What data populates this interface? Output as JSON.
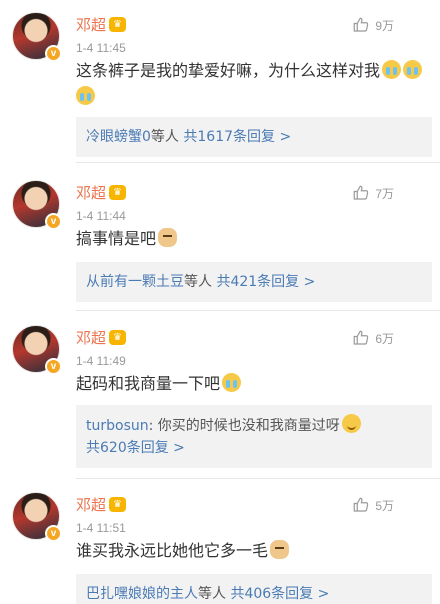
{
  "comments": [
    {
      "name": "邓超",
      "time": "1-4 11:45",
      "likes": "9万",
      "text": "这条裤子是我的挚爱好嘛，为什么这样对我",
      "emojis": [
        "cry",
        "cry",
        "cry"
      ],
      "reply": {
        "user": "冷眼螃蟹0",
        "suffix": "等人",
        "count_text": "共1617条回复 >"
      }
    },
    {
      "name": "邓超",
      "time": "1-4 11:44",
      "likes": "7万",
      "text": "搞事情是吧",
      "emojis": [
        "dog"
      ],
      "reply": {
        "user": "从前有一颗土豆",
        "suffix": "等人",
        "count_text": "共421条回复 >"
      }
    },
    {
      "name": "邓超",
      "time": "1-4 11:49",
      "likes": "6万",
      "text": "起码和我商量一下吧",
      "emojis": [
        "cry"
      ],
      "reply": {
        "user": "turbosun",
        "message": ": 你买的时候也没和我商量过呀",
        "count_text": "共620条回复 >"
      }
    },
    {
      "name": "邓超",
      "time": "1-4 11:51",
      "likes": "5万",
      "text": "谁买我永远比她他它多一毛",
      "emojis": [
        "dog"
      ],
      "reply": {
        "user": "巴扎嘿娘娘的主人",
        "suffix": "等人",
        "count_text": "共406条回复 >"
      }
    }
  ],
  "icons": {
    "like": "thumbs-up-icon",
    "verified": "verified-v-icon",
    "vip": "vip-crown-icon"
  },
  "colors": {
    "name": "#eb7350",
    "link": "#4a7bb5",
    "reply_bg": "#f2f2f2",
    "verified": "#f5a623"
  },
  "badges": {
    "verified_letter": "v",
    "vip_letter": "♛"
  }
}
